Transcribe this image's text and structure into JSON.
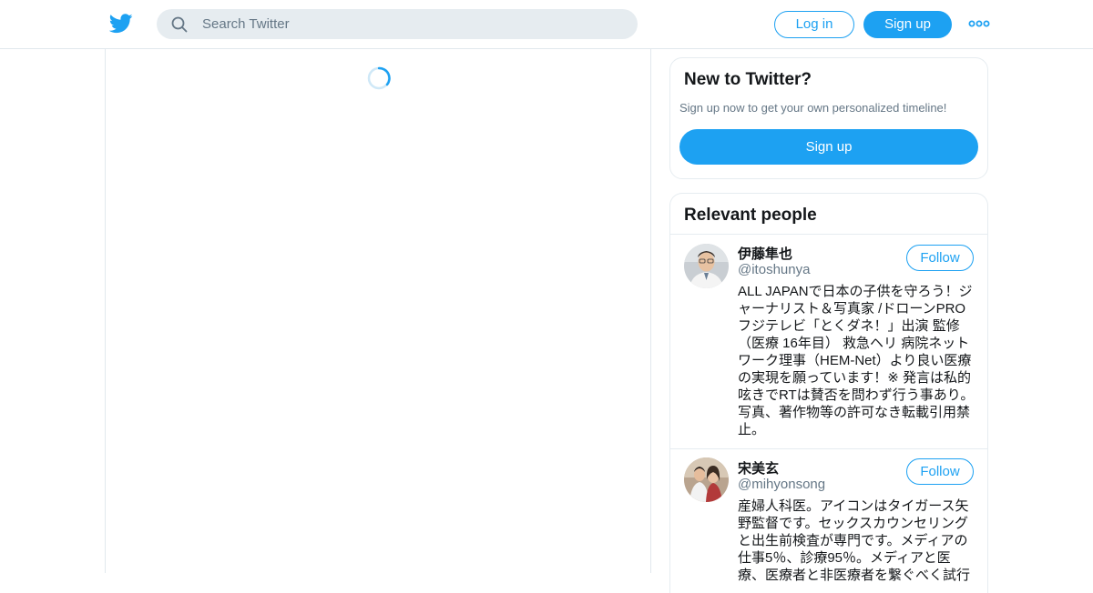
{
  "header": {
    "logo_icon": "twitter-bird-icon",
    "search_placeholder": "Search Twitter",
    "login_label": "Log in",
    "signup_label": "Sign up",
    "more_icon": "more-dots-icon",
    "accent_color": "#1da1f2"
  },
  "timeline": {
    "loading_icon": "loading-spinner-icon"
  },
  "new_to_twitter": {
    "title": "New to Twitter?",
    "subtitle": "Sign up now to get your own personalized timeline!",
    "signup_label": "Sign up"
  },
  "relevant_people": {
    "title": "Relevant people",
    "people": [
      {
        "name": "伊藤隼也",
        "handle": "@itoshunya",
        "follow_label": "Follow",
        "bio": "ALL JAPANで日本の子供を守ろう！ジャーナリスト＆写真家 /ドローンPRO フジテレビ「とくダネ！」出演 監修（医療 16年目） 救急ヘリ 病院ネットワーク理事（HEM-Net）より良い医療の実現を願っています！※ 発言は私的呟きでRTは賛否を問わず行う事あり。写真、著作物等の許可なき転載引用禁止。"
      },
      {
        "name": "宋美玄",
        "handle": "@mihyonsong",
        "follow_label": "Follow",
        "bio": "産婦人科医。アイコンはタイガース矢野監督です。セックスカウンセリングと出生前検査が専門です。メディアの仕事5％、診療95％。メディアと医療、医療者と非医療者を繋ぐべく試行"
      }
    ]
  }
}
